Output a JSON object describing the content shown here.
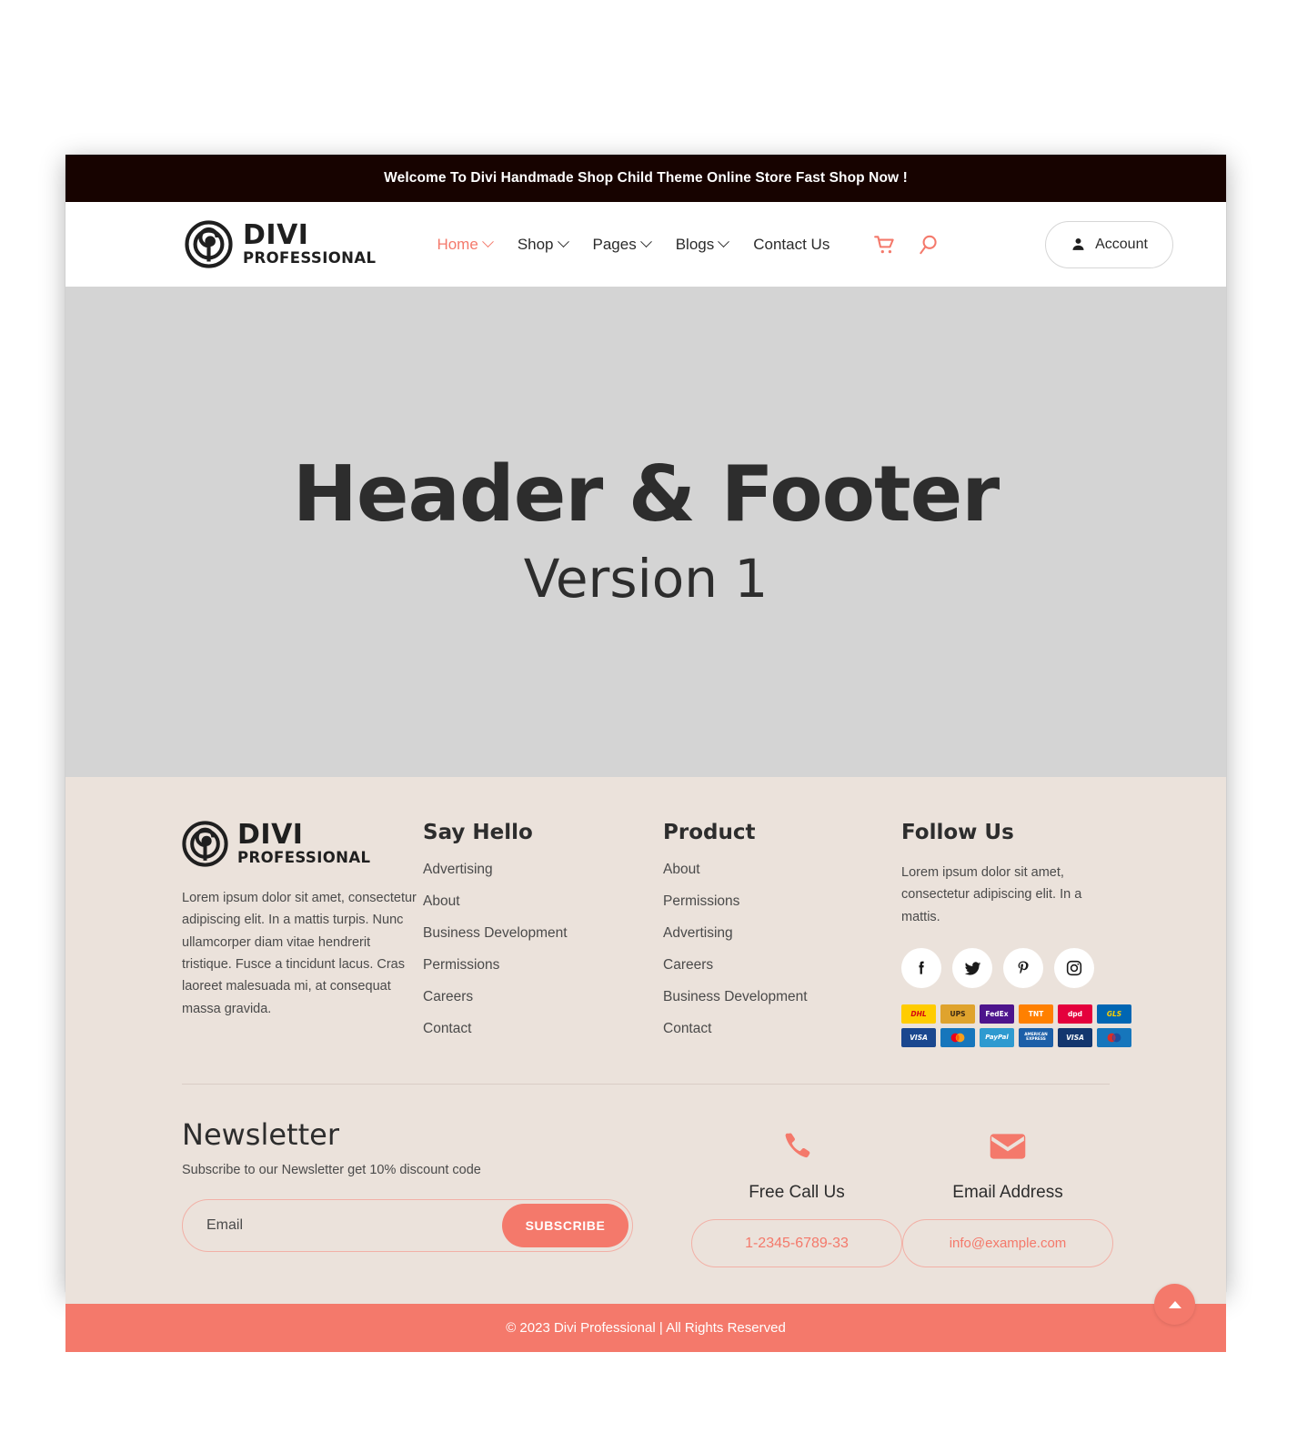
{
  "theme": {
    "accent": "#F4796B",
    "announce_bg": "#170300",
    "hero_bg": "#D4D4D4",
    "footer_bg": "#EBE2DB",
    "text_dark": "#2D2D2D"
  },
  "announcement": {
    "text": "Welcome To Divi Handmade Shop Child Theme Online Store Fast Shop Now !"
  },
  "header": {
    "logo": {
      "primary": "DIVI",
      "secondary": "PROFESSIONAL",
      "mark": "divi-spiral-logo-icon"
    },
    "nav": [
      {
        "label": "Home",
        "has_dropdown": true,
        "active": true
      },
      {
        "label": "Shop",
        "has_dropdown": true,
        "active": false
      },
      {
        "label": "Pages",
        "has_dropdown": true,
        "active": false
      },
      {
        "label": "Blogs",
        "has_dropdown": true,
        "active": false
      },
      {
        "label": "Contact Us",
        "has_dropdown": false,
        "active": false
      }
    ],
    "icons": [
      {
        "name": "shopping-cart-icon"
      },
      {
        "name": "search-icon"
      }
    ],
    "account_button": {
      "label": "Account",
      "icon": "user-icon"
    }
  },
  "hero": {
    "title": "Header & Footer",
    "subtitle": "Version 1"
  },
  "footer": {
    "brand": {
      "logo": {
        "primary": "DIVI",
        "secondary": "PROFESSIONAL"
      },
      "description": "Lorem ipsum dolor sit amet, consectetur adipiscing elit. In a mattis turpis. Nunc ullamcorper diam vitae hendrerit tristique. Fusce a tincidunt lacus. Cras laoreet malesuada mi, at consequat massa gravida."
    },
    "say_hello": {
      "heading": "Say Hello",
      "links": [
        "Advertising",
        "About",
        "Business Development",
        "Permissions",
        "Careers",
        "Contact"
      ]
    },
    "product": {
      "heading": "Product",
      "links": [
        "About",
        "Permissions",
        "Advertising",
        "Careers",
        "Business Development",
        "Contact"
      ]
    },
    "follow": {
      "heading": "Follow Us",
      "description": "Lorem ipsum dolor sit amet, consectetur adipiscing elit. In a mattis.",
      "socials": [
        {
          "name": "facebook-icon",
          "label": "Facebook"
        },
        {
          "name": "twitter-icon",
          "label": "Twitter"
        },
        {
          "name": "pinterest-icon",
          "label": "Pinterest"
        },
        {
          "name": "instagram-icon",
          "label": "Instagram"
        }
      ],
      "badges_shipping": [
        {
          "label": "DHL",
          "bg": "#FFCC00",
          "fg": "#D40511"
        },
        {
          "label": "UPS",
          "bg": "#DFA32D",
          "fg": "#3A2713"
        },
        {
          "label": "FedEx",
          "bg": "#4D148C",
          "fg": "#FFFFFF"
        },
        {
          "label": "TNT",
          "bg": "#FF8000",
          "fg": "#FFFFFF"
        },
        {
          "label": "dpd",
          "bg": "#E4003C",
          "fg": "#FFFFFF"
        },
        {
          "label": "GLS",
          "bg": "#0066B3",
          "fg": "#FFD100"
        }
      ],
      "badges_payment": [
        {
          "label": "VISA",
          "bg": "#1A478F",
          "fg": "#FFFFFF"
        },
        {
          "label": "Mastercard",
          "bg": "#1676BC",
          "fg": "#FFFFFF"
        },
        {
          "label": "PayPal",
          "bg": "#2E9AD0",
          "fg": "#FFFFFF"
        },
        {
          "label": "AMERICAN EXPRESS",
          "bg": "#1C5FA8",
          "fg": "#FFFFFF"
        },
        {
          "label": "VISA",
          "bg": "#13366E",
          "fg": "#FFFFFF"
        },
        {
          "label": "Maestro",
          "bg": "#1676BC",
          "fg": "#FFFFFF"
        }
      ]
    },
    "newsletter": {
      "heading": "Newsletter",
      "subtext": "Subscribe to our Newsletter get 10% discount code",
      "input_placeholder": "Email",
      "input_value": "",
      "button_label": "SUBSCRIBE"
    },
    "contacts": [
      {
        "icon": "phone-icon",
        "label": "Free Call Us",
        "value": "1-2345-6789-33"
      },
      {
        "icon": "envelope-icon",
        "label": "Email Address",
        "value": "info@example.com"
      }
    ],
    "copyright": "© 2023 Divi Professional | All Rights Reserved",
    "scroll_top": {
      "icon": "chevron-up-icon"
    }
  }
}
